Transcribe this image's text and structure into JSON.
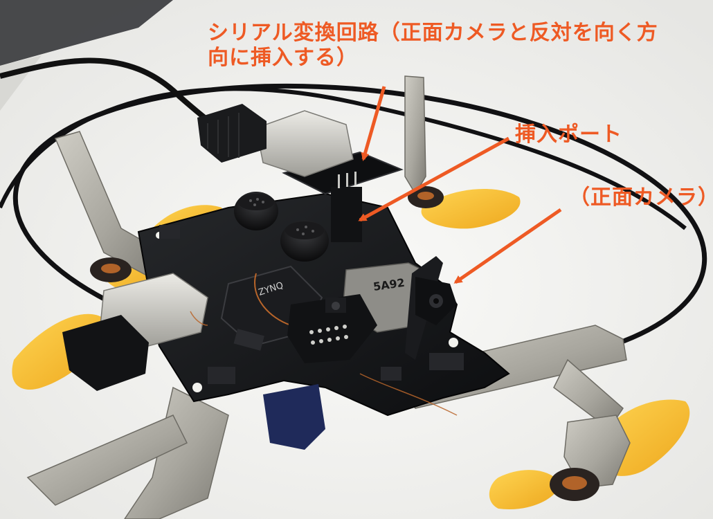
{
  "callouts": {
    "serial_converter": "シリアル変換回路（正面カメラと反対を向く方向に挿入する）",
    "insert_port": "挿入ポート",
    "front_camera": "（正面カメラ）"
  },
  "colors": {
    "callout_text": "#ee5a24",
    "arrow": "#ee5a24",
    "pcb": "#17181a",
    "propeller": "#f5b820",
    "metal_frame": "#a8a69e"
  },
  "board_marks": {
    "chip": "ZYNQ",
    "sd_label": "5A92"
  }
}
